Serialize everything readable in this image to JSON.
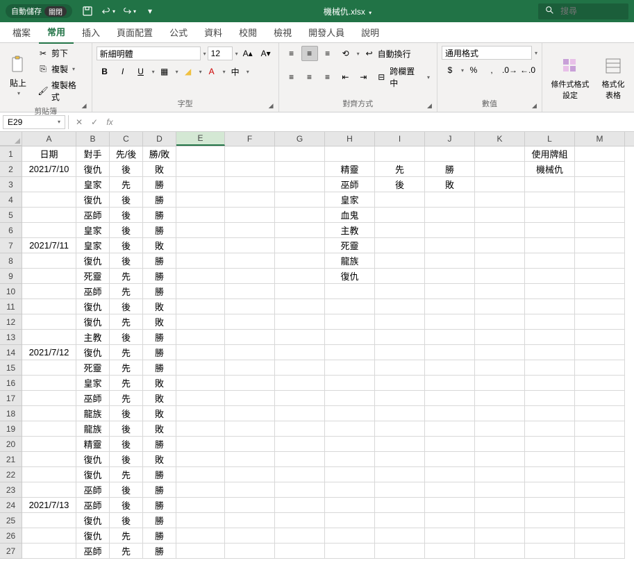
{
  "titlebar": {
    "autosave_label": "自動儲存",
    "autosave_state": "關閉",
    "filename": "機械仇.xlsx",
    "search_placeholder": "搜尋"
  },
  "tabs": [
    "檔案",
    "常用",
    "插入",
    "頁面配置",
    "公式",
    "資料",
    "校閱",
    "檢視",
    "開發人員",
    "說明"
  ],
  "active_tab": 1,
  "ribbon": {
    "clipboard": {
      "label": "剪貼簿",
      "paste": "貼上",
      "cut": "剪下",
      "copy": "複製",
      "format_painter": "複製格式"
    },
    "font": {
      "label": "字型",
      "name": "新細明體",
      "size": "12"
    },
    "alignment": {
      "label": "對齊方式",
      "wrap": "自動換行",
      "merge": "跨欄置中"
    },
    "number": {
      "label": "數值",
      "format": "通用格式"
    },
    "styles": {
      "conditional": "條件式格式設定",
      "format_table": "格式化表格"
    }
  },
  "name_box": "E29",
  "formula_value": "",
  "columns": [
    "A",
    "B",
    "C",
    "D",
    "E",
    "F",
    "G",
    "H",
    "I",
    "J",
    "K",
    "L",
    "M"
  ],
  "rows": [
    {
      "n": 1,
      "A": "日期",
      "B": "對手",
      "C": "先/後",
      "D": "勝/敗",
      "L": "使用牌組"
    },
    {
      "n": 2,
      "A": "2021/7/10",
      "B": "復仇",
      "C": "後",
      "D": "敗",
      "H": "精靈",
      "I": "先",
      "J": "勝",
      "L": "機械仇"
    },
    {
      "n": 3,
      "B": "皇家",
      "C": "先",
      "D": "勝",
      "H": "巫師",
      "I": "後",
      "J": "敗"
    },
    {
      "n": 4,
      "B": "復仇",
      "C": "後",
      "D": "勝",
      "H": "皇家"
    },
    {
      "n": 5,
      "B": "巫師",
      "C": "後",
      "D": "勝",
      "H": "血鬼"
    },
    {
      "n": 6,
      "B": "皇家",
      "C": "後",
      "D": "勝",
      "H": "主教"
    },
    {
      "n": 7,
      "A": "2021/7/11",
      "B": "皇家",
      "C": "後",
      "D": "敗",
      "H": "死靈"
    },
    {
      "n": 8,
      "B": "復仇",
      "C": "後",
      "D": "勝",
      "H": "龍族"
    },
    {
      "n": 9,
      "B": "死靈",
      "C": "先",
      "D": "勝",
      "H": "復仇"
    },
    {
      "n": 10,
      "B": "巫師",
      "C": "先",
      "D": "勝"
    },
    {
      "n": 11,
      "B": "復仇",
      "C": "後",
      "D": "敗"
    },
    {
      "n": 12,
      "B": "復仇",
      "C": "先",
      "D": "敗"
    },
    {
      "n": 13,
      "B": "主教",
      "C": "後",
      "D": "勝"
    },
    {
      "n": 14,
      "A": "2021/7/12",
      "B": "復仇",
      "C": "先",
      "D": "勝"
    },
    {
      "n": 15,
      "B": "死靈",
      "C": "先",
      "D": "勝"
    },
    {
      "n": 16,
      "B": "皇家",
      "C": "先",
      "D": "敗"
    },
    {
      "n": 17,
      "B": "巫師",
      "C": "先",
      "D": "敗"
    },
    {
      "n": 18,
      "B": "龍族",
      "C": "後",
      "D": "敗"
    },
    {
      "n": 19,
      "B": "龍族",
      "C": "後",
      "D": "敗"
    },
    {
      "n": 20,
      "B": "精靈",
      "C": "後",
      "D": "勝"
    },
    {
      "n": 21,
      "B": "復仇",
      "C": "後",
      "D": "敗"
    },
    {
      "n": 22,
      "B": "復仇",
      "C": "先",
      "D": "勝"
    },
    {
      "n": 23,
      "B": "巫師",
      "C": "後",
      "D": "勝"
    },
    {
      "n": 24,
      "A": "2021/7/13",
      "B": "巫師",
      "C": "後",
      "D": "勝"
    },
    {
      "n": 25,
      "B": "復仇",
      "C": "後",
      "D": "勝"
    },
    {
      "n": 26,
      "B": "復仇",
      "C": "先",
      "D": "勝"
    },
    {
      "n": 27,
      "B": "巫師",
      "C": "先",
      "D": "勝"
    }
  ]
}
